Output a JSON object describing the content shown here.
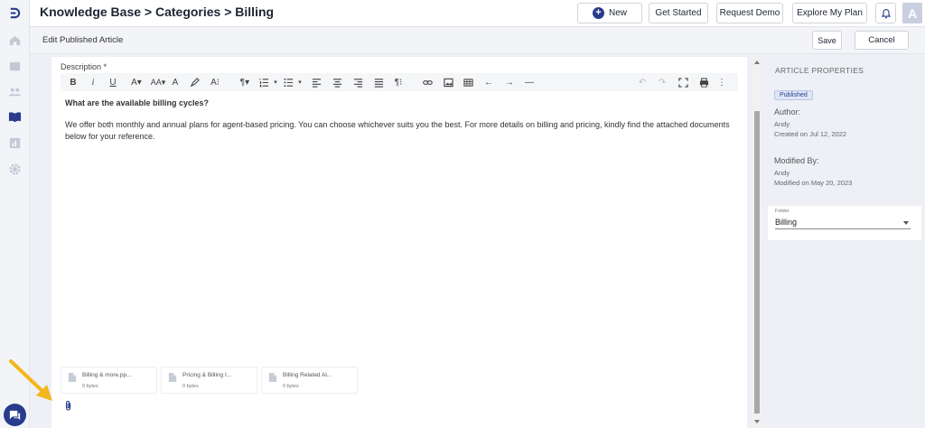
{
  "header": {
    "title": "Knowledge Base > Categories > Billing",
    "new_label": "New",
    "get_started_label": "Get Started",
    "request_demo_label": "Request Demo",
    "explore_plan_label": "Explore My Plan",
    "avatar_letter": "A"
  },
  "subheader": {
    "title": "Edit Published Article",
    "save_label": "Save",
    "cancel_label": "Cancel"
  },
  "editor": {
    "description_label": "Description *",
    "question": "What are the available billing cycles?",
    "answer": "We offer both monthly and annual plans for agent-based pricing. You can choose whichever suits you the best. For more details on billing and pricing, kindly find the attached documents below for your reference."
  },
  "attachments": [
    {
      "name": "Billing & more.pp...",
      "size": "0 bytes"
    },
    {
      "name": "Pricing & Billing I...",
      "size": "0 bytes"
    },
    {
      "name": "Billing Related Al...",
      "size": "0 bytes"
    }
  ],
  "properties": {
    "title": "ARTICLE PROPERTIES",
    "status": "Published",
    "author_label": "Author:",
    "author": "Andy",
    "created": "Created on Jul 12, 2022",
    "modified_label": "Modified By:",
    "modified_by": "Andy",
    "modified": "Modified on May 20, 2023",
    "folder_caption": "Folder",
    "folder_value": "Billing"
  },
  "colors": {
    "accent": "#283b8c",
    "arrow": "#f2b61e"
  }
}
